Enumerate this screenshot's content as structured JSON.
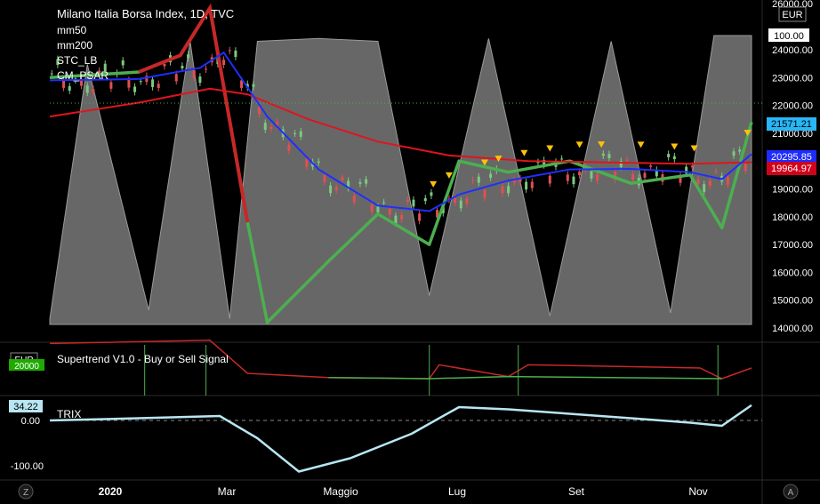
{
  "header": {
    "title": "Milano Italia Borsa Index, 1D, TVC",
    "indicators": [
      "mm50",
      "mm200",
      "STC_LB",
      "CM_PSAR"
    ]
  },
  "price_axis": {
    "currency": "EUR",
    "ticks": [
      "26000.00",
      "24000.00",
      "23000.00",
      "22000.00",
      "21000.00",
      "20000.00",
      "19000.00",
      "18000.00",
      "17000.00",
      "16000.00",
      "15000.00",
      "14000.00"
    ],
    "stc_badge": "100.00",
    "badges": [
      {
        "text": "21571.21",
        "bg": "#29b6f6",
        "fg": "#000000"
      },
      {
        "text": "20295.85",
        "bg": "#1e2cff",
        "fg": "#ffffff"
      },
      {
        "text": "19964.97",
        "bg": "#d0021b",
        "fg": "#ffffff"
      }
    ]
  },
  "supertrend": {
    "label": "Supertrend V1.0 - Buy or Sell Signal",
    "axis_currency": "EUR",
    "badge_text": "20000"
  },
  "trix": {
    "label": "TRIX",
    "badge_text": "34.22",
    "ticks": [
      "0.00",
      "-100.00"
    ]
  },
  "time_axis": {
    "labels": [
      "2020",
      "Mar",
      "Maggio",
      "Lug",
      "Set",
      "Nov"
    ]
  },
  "corner_buttons": {
    "left": "Z",
    "right": "A"
  },
  "colors": {
    "background": "#000000",
    "mm50": "#1f2fff",
    "mm200": "#e0141e",
    "stc_fill": "#8a8a8a",
    "psar_up": "#4caf50",
    "psar_down": "#c62828",
    "candle_up": "#7ec97e",
    "candle_down": "#e05050",
    "signal": "#ffc107",
    "trix": "#b8e6f2",
    "axis_text": "#ffffff"
  },
  "chart_data": [
    {
      "type": "line",
      "title": "Milano Italia Borsa Index, 1D, TVC",
      "x_range": [
        "2019-12-01",
        "2020-11-20"
      ],
      "ylim": [
        14000,
        26000
      ],
      "series": [
        {
          "name": "mm50",
          "x": [
            "2019-12-01",
            "2020-01-15",
            "2020-02-15",
            "2020-02-27",
            "2020-03-20",
            "2020-04-15",
            "2020-05-15",
            "2020-06-10",
            "2020-06-25",
            "2020-07-20",
            "2020-08-20",
            "2020-09-20",
            "2020-10-20",
            "2020-11-05",
            "2020-11-20"
          ],
          "values": [
            22900,
            22950,
            23350,
            23900,
            21600,
            19700,
            18400,
            18200,
            18800,
            19300,
            19700,
            19720,
            19600,
            19350,
            20250
          ]
        },
        {
          "name": "mm200",
          "x": [
            "2019-12-01",
            "2020-01-15",
            "2020-02-20",
            "2020-03-10",
            "2020-04-10",
            "2020-05-15",
            "2020-06-20",
            "2020-07-30",
            "2020-09-10",
            "2020-10-20",
            "2020-11-20"
          ],
          "values": [
            21600,
            22100,
            22600,
            22400,
            21500,
            20700,
            20200,
            20000,
            19950,
            19900,
            19960
          ]
        },
        {
          "name": "CM_PSAR",
          "x": [
            "2019-12-01",
            "2020-01-15",
            "2020-02-05",
            "2020-02-20",
            "2020-03-10",
            "2020-03-20",
            "2020-04-20",
            "2020-05-15",
            "2020-06-10",
            "2020-06-25",
            "2020-07-20",
            "2020-08-20",
            "2020-09-20",
            "2020-10-20",
            "2020-11-05",
            "2020-11-20"
          ],
          "values": [
            23000,
            23200,
            23800,
            25500,
            17800,
            14200,
            16400,
            18100,
            17000,
            20000,
            19600,
            20000,
            19200,
            19500,
            17600,
            21400
          ]
        },
        {
          "name": "STC_LB",
          "x": [
            "2019-12-01",
            "2019-12-20",
            "2020-01-20",
            "2020-02-10",
            "2020-03-01",
            "2020-03-15",
            "2020-04-15",
            "2020-05-15",
            "2020-06-10",
            "2020-07-10",
            "2020-08-10",
            "2020-09-10",
            "2020-10-10",
            "2020-11-01",
            "2020-11-20"
          ],
          "values": [
            2,
            90,
            5,
            98,
            2,
            98,
            99,
            98,
            10,
            99,
            3,
            98,
            4,
            100,
            100
          ]
        }
      ]
    },
    {
      "type": "line",
      "title": "Supertrend V1.0 - Buy or Sell Signal",
      "series": [
        {
          "name": "Supertrend",
          "x": [
            "2019-12-01",
            "2020-02-20",
            "2020-03-10",
            "2020-04-20",
            "2020-06-10",
            "2020-06-15",
            "2020-07-20",
            "2020-07-30",
            "2020-10-25",
            "2020-11-05",
            "2020-11-20"
          ],
          "values": [
            22800,
            23100,
            20000,
            19600,
            19500,
            20800,
            19700,
            20800,
            20500,
            19500,
            20500
          ]
        }
      ]
    },
    {
      "type": "line",
      "title": "TRIX",
      "ylim": [
        -120,
        40
      ],
      "series": [
        {
          "name": "TRIX",
          "x": [
            "2019-12-01",
            "2020-01-15",
            "2020-02-25",
            "2020-03-15",
            "2020-04-05",
            "2020-05-01",
            "2020-06-01",
            "2020-06-25",
            "2020-07-20",
            "2020-08-20",
            "2020-09-20",
            "2020-10-20",
            "2020-11-05",
            "2020-11-20"
          ],
          "values": [
            0,
            5,
            10,
            -40,
            -115,
            -85,
            -30,
            30,
            25,
            15,
            5,
            -5,
            -12,
            34.22
          ]
        }
      ]
    }
  ]
}
